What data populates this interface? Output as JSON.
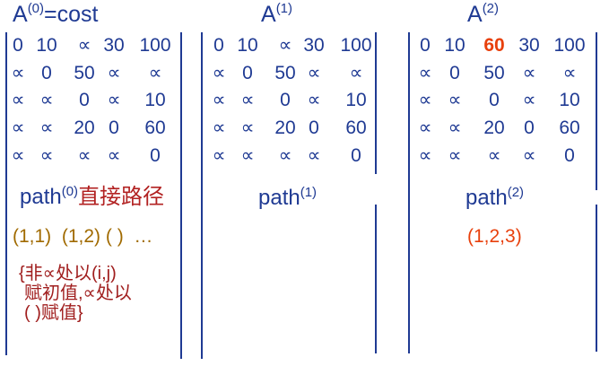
{
  "matrices": [
    {
      "title_base": "A",
      "title_sup": "(0)",
      "title_suffix": "=cost",
      "rows": [
        [
          "0",
          "10",
          "∝",
          "30",
          "100"
        ],
        [
          "∝",
          "0",
          "50",
          "∝",
          "∝"
        ],
        [
          "∝",
          "∝",
          "0",
          "∝",
          "10"
        ],
        [
          "∝",
          "∝",
          "20",
          "0",
          "60"
        ],
        [
          "∝",
          "∝",
          "∝",
          "∝",
          "0"
        ]
      ]
    },
    {
      "title_base": "A",
      "title_sup": "(1)",
      "title_suffix": "",
      "rows": [
        [
          "0",
          "10",
          "∝",
          "30",
          "100"
        ],
        [
          "∝",
          "0",
          "50",
          "∝",
          "∝"
        ],
        [
          "∝",
          "∝",
          "0",
          "∝",
          "10"
        ],
        [
          "∝",
          "∝",
          "20",
          "0",
          "60"
        ],
        [
          "∝",
          "∝",
          "∝",
          "∝",
          "0"
        ]
      ]
    },
    {
      "title_base": "A",
      "title_sup": "(2)",
      "title_suffix": "",
      "highlight": {
        "row": 0,
        "col": 2,
        "color": "#e8400c"
      },
      "rows": [
        [
          "0",
          "10",
          "60",
          "30",
          "100"
        ],
        [
          "∝",
          "0",
          "50",
          "∝",
          "∝"
        ],
        [
          "∝",
          "∝",
          "0",
          "∝",
          "10"
        ],
        [
          "∝",
          "∝",
          "20",
          "0",
          "60"
        ],
        [
          "∝",
          "∝",
          "∝",
          "∝",
          "0"
        ]
      ]
    }
  ],
  "paths": [
    {
      "base": "path",
      "sup": "(0)",
      "suffix": "直接路径",
      "value": "(1,1)  (1,2) ( )  …"
    },
    {
      "base": "path",
      "sup": "(1)",
      "suffix": "",
      "value": ""
    },
    {
      "base": "path",
      "sup": "(2)",
      "suffix": "",
      "value": "(1,2,3)"
    }
  ],
  "note": [
    "{非∝处以(i,j)",
    "赋初值,∝处以",
    "( )赋值}"
  ],
  "colors": {
    "primary": "#1f3a93",
    "highlight": "#e8400c",
    "note": "#a01e1e",
    "path0": "#a06a00"
  }
}
